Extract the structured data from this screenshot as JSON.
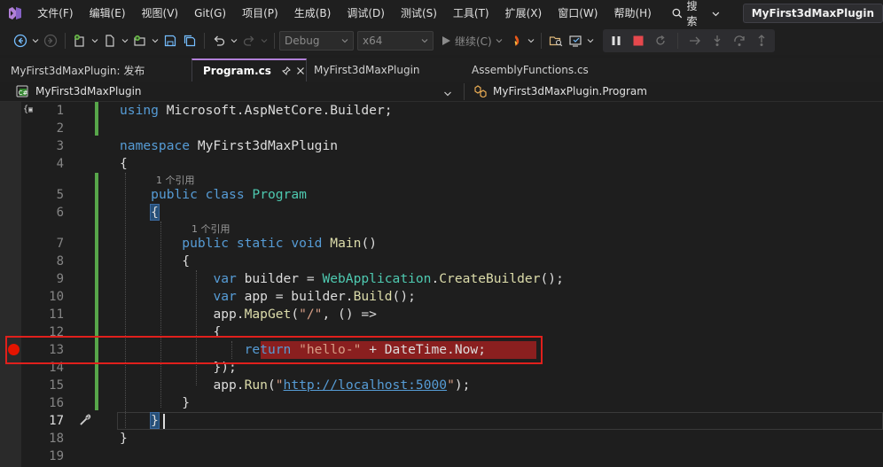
{
  "menu": {
    "items": [
      "文件(F)",
      "编辑(E)",
      "视图(V)",
      "Git(G)",
      "项目(P)",
      "生成(B)",
      "调试(D)",
      "测试(S)",
      "工具(T)",
      "扩展(X)",
      "窗口(W)",
      "帮助(H)"
    ],
    "search_label": "搜索",
    "solution_title": "MyFirst3dMaxPlugin"
  },
  "toolbar": {
    "config": "Debug",
    "platform": "x64",
    "continue_label": "继续(C)"
  },
  "tabs": [
    {
      "label": "MyFirst3dMaxPlugin: 发布",
      "active": false
    },
    {
      "label": "Program.cs",
      "active": true
    },
    {
      "label": "MyFirst3dMaxPlugin",
      "active": false
    },
    {
      "label": "AssemblyFunctions.cs",
      "active": false
    }
  ],
  "navbar": {
    "project": "MyFirst3dMaxPlugin",
    "class": "MyFirst3dMaxPlugin.Program"
  },
  "editor": {
    "line_numbers": [
      "1",
      "2",
      "3",
      "4",
      "5",
      "6",
      "7",
      "8",
      "9",
      "10",
      "11",
      "12",
      "13",
      "14",
      "15",
      "16",
      "17",
      "18",
      "19"
    ],
    "current_line": "17",
    "breakpoint_line": "13",
    "codelens": [
      "1 个引用",
      "1 个引用"
    ],
    "code": {
      "l1": {
        "kw": "using",
        "rest": " Microsoft.AspNetCore.Builder;"
      },
      "l3": {
        "kw": "namespace",
        "rest": " MyFirst3dMaxPlugin"
      },
      "l4": "{",
      "l5": {
        "kw1": "public",
        "kw2": "class",
        "cls": "Program"
      },
      "l6": "{",
      "l7": {
        "kw1": "public",
        "kw2": "static",
        "kw3": "void",
        "fn": "Main",
        "rest": "()"
      },
      "l8": "{",
      "l9": {
        "kw": "var",
        "rest1": " builder = ",
        "cls": "WebApplication",
        "dot": ".",
        "fn": "CreateBuilder",
        "rest2": "();"
      },
      "l10": {
        "kw": "var",
        "rest1": " app = builder.",
        "fn": "Build",
        "rest2": "();"
      },
      "l11": {
        "pre": "app.",
        "fn": "MapGet",
        "open": "(",
        "str": "\"/\"",
        "rest": ", () =>"
      },
      "l12": "{",
      "l13": {
        "kw": "return",
        "sp": " ",
        "str": "\"hello-\"",
        "rest": " + DateTime.Now;"
      },
      "l14": "});",
      "l15": {
        "pre": "app.",
        "fn": "Run",
        "open": "(",
        "q1": "\"",
        "url": "http://localhost:5000",
        "q2": "\"",
        "rest": ");"
      },
      "l16": "}",
      "l17": "}",
      "l18": "}"
    }
  }
}
